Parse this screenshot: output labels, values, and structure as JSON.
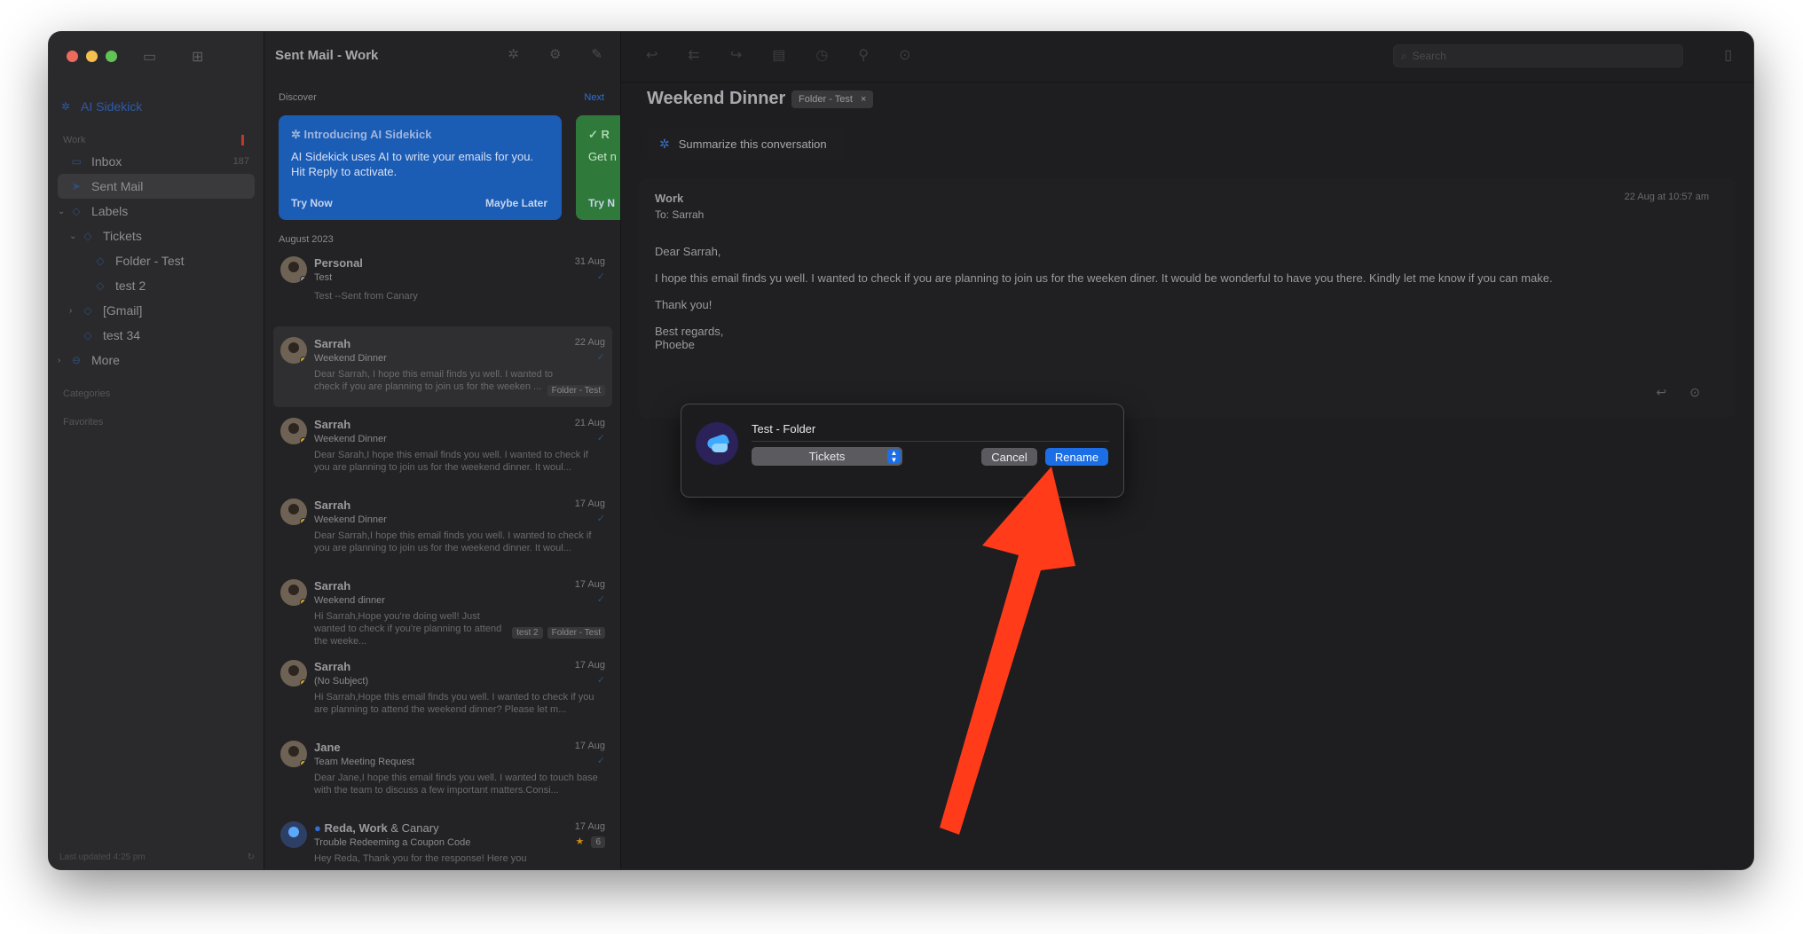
{
  "window": {
    "traffic_colors": [
      "#ed6a5e",
      "#f5bf4f",
      "#61c554"
    ]
  },
  "sidebar": {
    "ai_sidekick": "AI Sidekick",
    "section_work": "Work",
    "items": [
      {
        "label": "Inbox",
        "count": "187",
        "icon": "tray-icon"
      },
      {
        "label": "Sent Mail",
        "icon": "paperplane-icon"
      },
      {
        "label": "Labels",
        "icon": "tag-icon"
      },
      {
        "label": "Tickets",
        "icon": "tag-icon"
      },
      {
        "label": "Folder - Test",
        "icon": "tag-icon"
      },
      {
        "label": "test 2",
        "icon": "tag-icon"
      },
      {
        "label": "[Gmail]",
        "icon": "tag-icon"
      },
      {
        "label": "test 34",
        "icon": "tag-icon"
      },
      {
        "label": "More",
        "icon": "ellipsis-circle-icon"
      }
    ],
    "section_categories": "Categories",
    "section_favorites": "Favorites",
    "footer": "Last updated 4:25 pm"
  },
  "message_list": {
    "title": "Sent Mail - Work",
    "discover": "Discover",
    "next": "Next",
    "promo": {
      "title": "Introducing AI Sidekick",
      "body": "AI Sidekick uses AI to write your emails for you. Hit Reply to activate.",
      "try_now": "Try Now",
      "maybe_later": "Maybe Later"
    },
    "promo2": {
      "title": "R",
      "body": "Get n",
      "action": "Try N"
    },
    "month": "August 2023",
    "messages": [
      {
        "from": "Personal",
        "date": "31 Aug",
        "subject": "Test",
        "preview": "Test --Sent from Canary",
        "tags": []
      },
      {
        "from": "Sarrah",
        "date": "22 Aug",
        "subject": "Weekend Dinner",
        "preview": "Dear Sarrah, I hope this email finds yu well. I wanted to check if you are planning to join us for the weeken ...",
        "tags": [
          "Folder - Test"
        ]
      },
      {
        "from": "Sarrah",
        "date": "21 Aug",
        "subject": "Weekend Dinner",
        "preview": "Dear Sarah,I hope this email finds you well. I wanted to check if you are planning to join us for the weekend dinner. It woul...",
        "tags": []
      },
      {
        "from": "Sarrah",
        "date": "17 Aug",
        "subject": "Weekend Dinner",
        "preview": "Dear Sarrah,I hope this email finds you well. I wanted to check if you are planning to join us for the weekend dinner. It woul...",
        "tags": []
      },
      {
        "from": "Sarrah",
        "date": "17 Aug",
        "subject": "Weekend dinner",
        "preview": "Hi Sarrah,Hope you're doing well! Just wanted to check if you're planning to attend the weeke...",
        "tags": [
          "test 2",
          "Folder - Test"
        ]
      },
      {
        "from": "Sarrah",
        "date": "17 Aug",
        "subject": "(No Subject)",
        "preview": "Hi Sarrah,Hope this email finds you well. I wanted to check if you are planning to attend the weekend dinner? Please let m...",
        "tags": []
      },
      {
        "from": "Jane",
        "date": "17 Aug",
        "subject": "Team Meeting Request",
        "preview": "Dear Jane,I hope this email finds you well. I wanted to touch base with the team to discuss a few important matters.Consi...",
        "tags": []
      },
      {
        "from": "Reda, Work",
        "from_suffix": "& Canary",
        "date": "17 Aug",
        "subject": "Trouble Redeeming a Coupon Code",
        "preview": "Hey Reda, Thank you for the response! Here you",
        "count": "6",
        "tags": []
      }
    ]
  },
  "reader": {
    "search_placeholder": "Search",
    "subject": "Weekend Dinner",
    "subject_tag": "Folder - Test",
    "summarize": "Summarize this conversation",
    "email": {
      "sender": "Work",
      "to": "To: Sarrah",
      "date": "22 Aug at 10:57 am",
      "greeting": "Dear Sarrah,",
      "body": "I hope this email finds yu well. I wanted to check if you are planning to join us for the weeken diner. It would be wonderful to have you there. Kindly let me know if you can make.",
      "thanks": "Thank you!",
      "closing": "Best regards,",
      "signature": "Phoebe"
    }
  },
  "dialog": {
    "name_value": "Test - Folder",
    "parent_select": "Tickets",
    "cancel": "Cancel",
    "rename": "Rename"
  },
  "annotation": {
    "arrow_color": "#ff3b1a"
  }
}
